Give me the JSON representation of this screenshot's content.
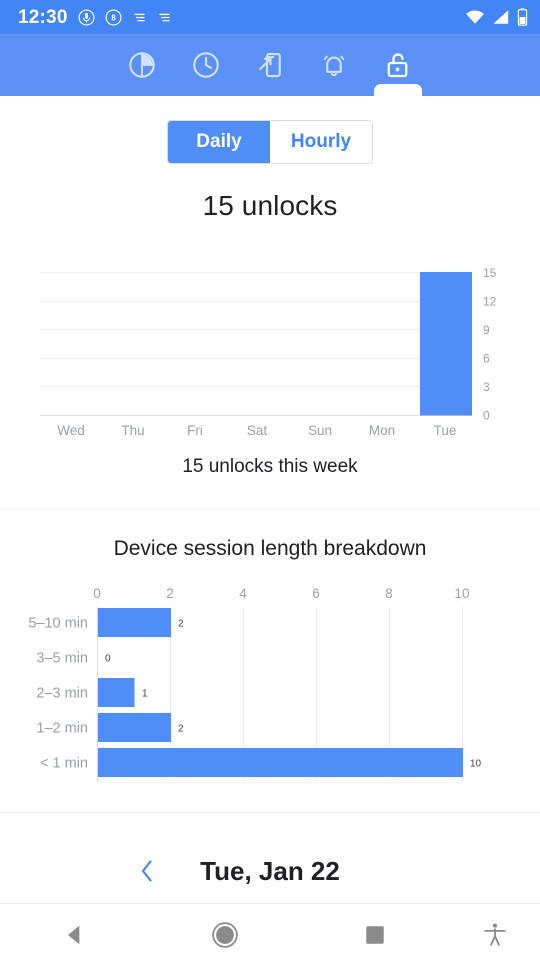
{
  "status_bar": {
    "time": "12:30",
    "left_icons": [
      "microphone-circle-icon",
      "eight-circle-icon",
      "notification-lines-icon",
      "notification-lines-icon"
    ],
    "right_icons": [
      "wifi-icon",
      "cell-signal-icon",
      "battery-icon"
    ],
    "background": "#4285f4"
  },
  "tab_bar": {
    "background": "#5b90f5",
    "active_index": 4,
    "tabs": [
      {
        "name": "pie-chart-tab",
        "icon": "pie-chart-icon"
      },
      {
        "name": "clock-tab",
        "icon": "clock-icon"
      },
      {
        "name": "device-launch-tab",
        "icon": "phone-arrow-icon"
      },
      {
        "name": "notifications-tab",
        "icon": "bell-icon"
      },
      {
        "name": "unlocks-tab",
        "icon": "unlock-padlock-icon"
      }
    ]
  },
  "segmented_control": {
    "options": [
      {
        "label": "Daily",
        "selected": true
      },
      {
        "label": "Hourly",
        "selected": false
      }
    ],
    "selected_color": "#4f8ef7",
    "text_color": "#4285f4"
  },
  "headline": "15 unlocks",
  "weekly_caption": "15 unlocks this week",
  "breakdown_title": "Device session length breakdown",
  "date_nav": {
    "prev_icon": "chevron-left-icon",
    "label": "Tue, Jan 22",
    "chevron_color": "#4285f4"
  },
  "nav_bar": {
    "buttons": [
      {
        "name": "back-button",
        "icon": "back-triangle-icon"
      },
      {
        "name": "home-button",
        "icon": "home-circle-icon"
      },
      {
        "name": "recents-button",
        "icon": "recents-square-icon"
      },
      {
        "name": "accessibility-button",
        "icon": "accessibility-icon"
      }
    ]
  },
  "chart_data": [
    {
      "type": "bar",
      "name": "daily-unlocks",
      "title": "",
      "categories": [
        "Wed",
        "Thu",
        "Fri",
        "Sat",
        "Sun",
        "Mon",
        "Tue"
      ],
      "values": [
        0,
        0,
        0,
        0,
        0,
        0,
        15
      ],
      "yticks": [
        0,
        3,
        6,
        9,
        12,
        15
      ],
      "ylim": [
        0,
        15
      ],
      "xlabel": "",
      "ylabel": "",
      "grid": true,
      "bar_color": "#4f8ef7",
      "tick_color": "#9aa0a6"
    },
    {
      "type": "bar",
      "name": "session-length-breakdown",
      "orientation": "horizontal",
      "title": "Device session length breakdown",
      "categories": [
        "5–10 min",
        "3–5 min",
        "2–3 min",
        "1–2 min",
        "< 1 min"
      ],
      "values": [
        2,
        0,
        1,
        2,
        10
      ],
      "value_labels": [
        "2",
        "0",
        "1",
        "2",
        "10"
      ],
      "xticks": [
        0,
        2,
        4,
        6,
        8,
        10
      ],
      "xlim": [
        0,
        10
      ],
      "xlabel": "",
      "ylabel": "",
      "grid": true,
      "bar_color": "#4f8ef7",
      "tick_color": "#9aa0a6"
    }
  ]
}
